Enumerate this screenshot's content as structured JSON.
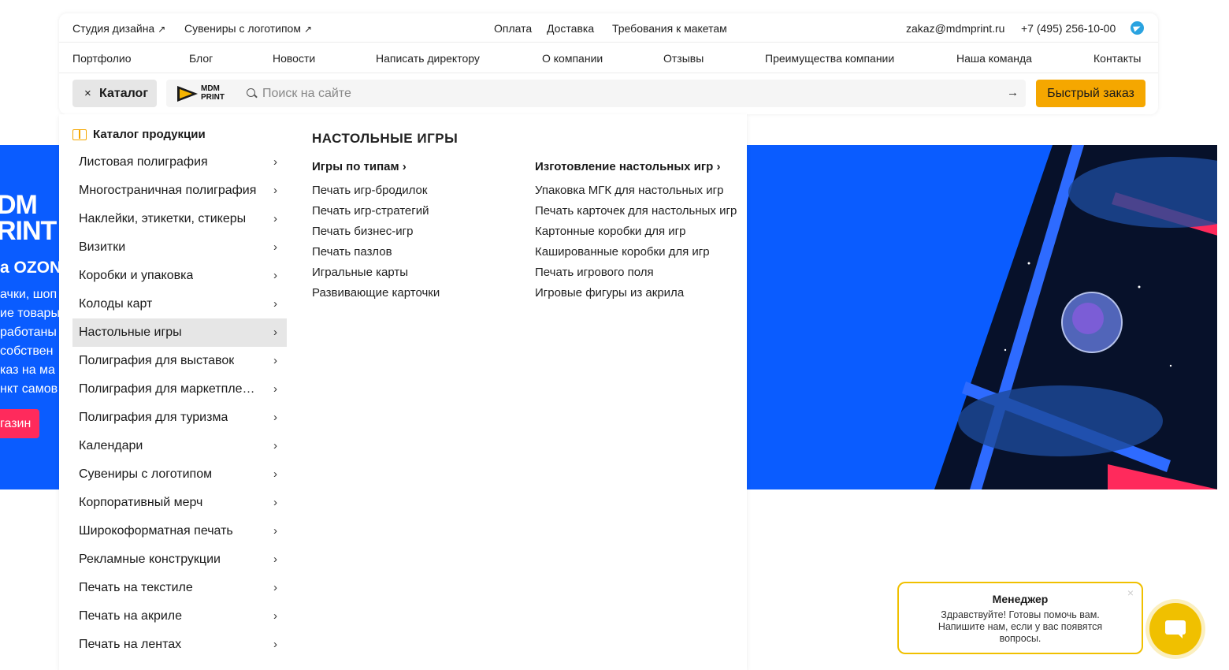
{
  "hero": {
    "logo_line1": "DM",
    "logo_line2": "RINT",
    "ozon": "a OZON",
    "text_lines": [
      "ачки, шоп",
      "ие товары",
      "работаны и",
      "собствен",
      "каз на ма",
      "нкт самов"
    ],
    "button": "газин"
  },
  "topbar": {
    "links_left": [
      {
        "label": "Студия дизайна",
        "icon": "external-arrow-icon"
      },
      {
        "label": "Сувениры с логотипом",
        "icon": "external-arrow-icon"
      }
    ],
    "links_center": [
      "Оплата",
      "Доставка",
      "Требования к макетам"
    ],
    "email": "zakaz@mdmprint.ru",
    "phone": "+7 (495) 256-10-00",
    "telegram_icon": "telegram-icon"
  },
  "nav": [
    "Портфолио",
    "Блог",
    "Новости",
    "Написать директору",
    "О компании",
    "Отзывы",
    "Преимущества компании",
    "Наша команда",
    "Контакты"
  ],
  "searchbar": {
    "catalog_label": "Каталог",
    "close_glyph": "×",
    "logo_line1": "MDM",
    "logo_line2": "PRINT",
    "search_placeholder": "Поиск на сайте",
    "submit_glyph": "→",
    "quick_order_label": "Быстрый заказ",
    "accent_color": "#f5a700"
  },
  "catalog": {
    "title": "Каталог продукции",
    "items": [
      "Листовая полиграфия",
      "Многостраничная полиграфия",
      "Наклейки, этикетки, стикеры",
      "Визитки",
      "Коробки и упаковка",
      "Колоды карт",
      "Настольные игры",
      "Полиграфия для выставок",
      "Полиграфия для маркетплейсов",
      "Полиграфия для туризма",
      "Календари",
      "Сувениры с логотипом",
      "Корпоративный мерч",
      "Широкоформатная печать",
      "Рекламные конструкции",
      "Печать на текстиле",
      "Печать на акриле",
      "Печать на лентах"
    ],
    "active_item": "Настольные игры",
    "chevron": "›"
  },
  "submenu": {
    "heading": "НАСТОЛЬНЫЕ ИГРЫ",
    "columns": [
      {
        "title": "Игры по типам ›",
        "links": [
          "Печать игр-бродилок",
          "Печать игр-стратегий",
          "Печать бизнес-игр",
          "Печать пазлов",
          "Игральные карты",
          "Развивающие карточки"
        ]
      },
      {
        "title": "Изготовление настольных игр ›",
        "links": [
          "Упаковка МГК для настольных игр",
          "Печать карточек для настольных игр",
          "Картонные коробки для игр",
          "Кашированные коробки для игр",
          "Печать игрового поля",
          "Игровые фигуры из акрила"
        ]
      }
    ]
  },
  "chat": {
    "title": "Менеджер",
    "message": "Здравствуйте! Готовы помочь вам. Напишите нам, если у вас появятся вопросы.",
    "close_glyph": "×",
    "accent_color": "#f0c000"
  }
}
